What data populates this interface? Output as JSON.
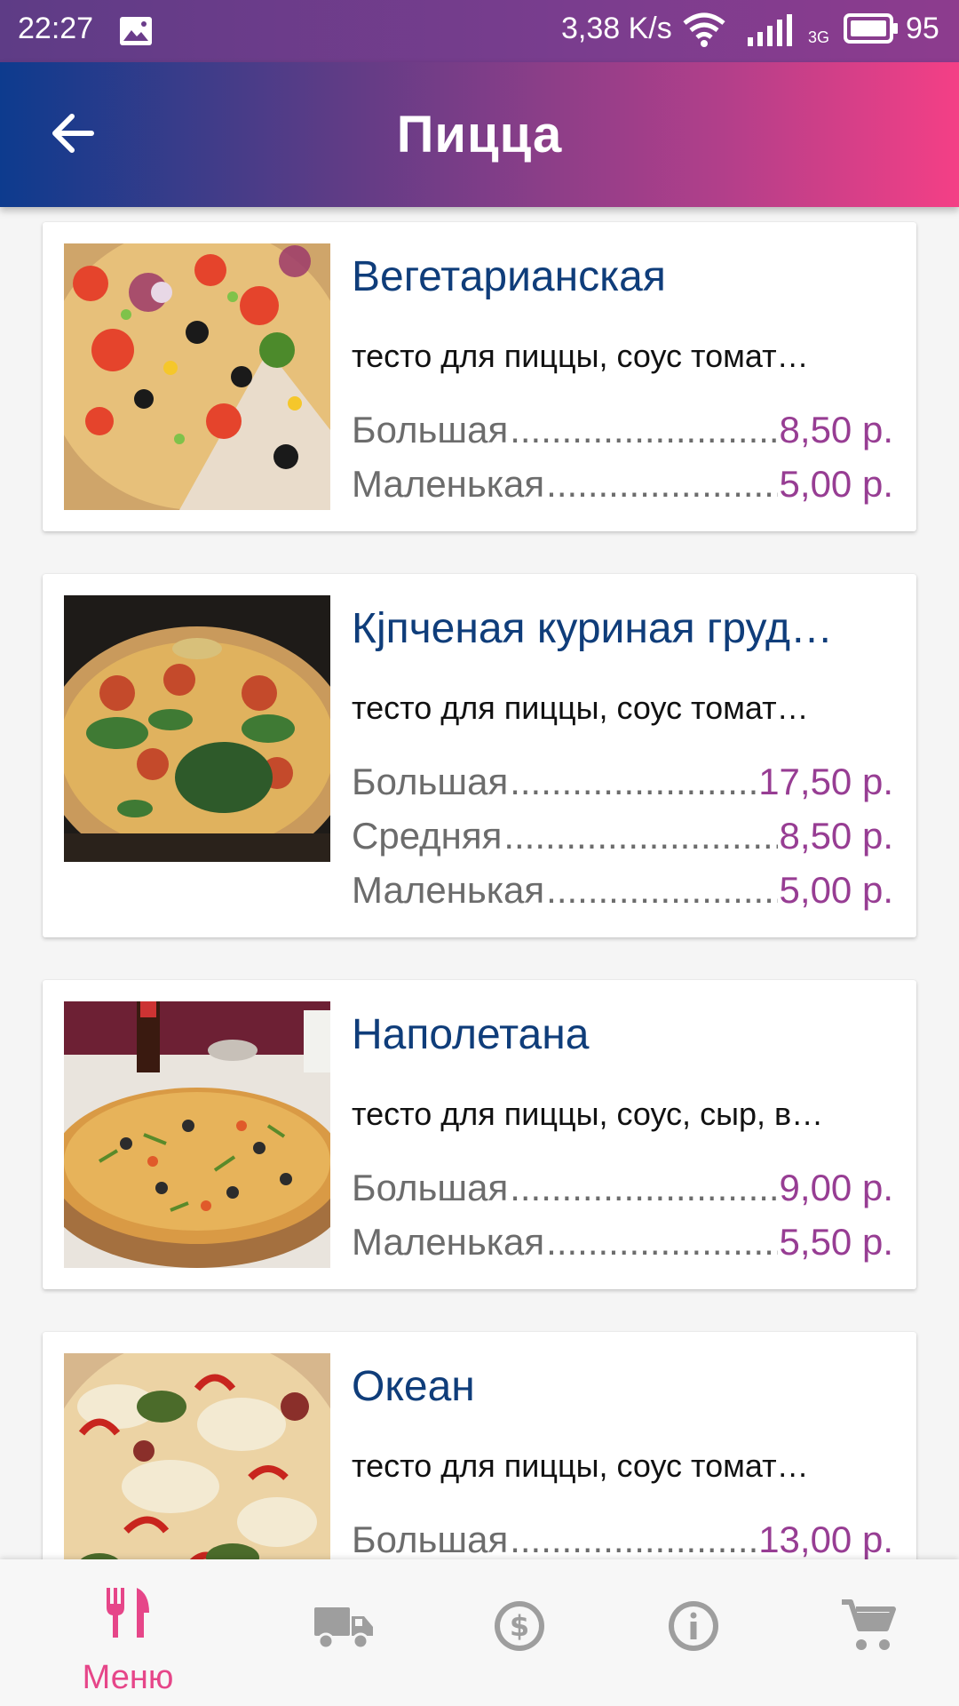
{
  "status_bar": {
    "time": "22:27",
    "speed": "3,38 K/s",
    "network": "3G",
    "battery": "95"
  },
  "app_bar": {
    "title": "Пицца",
    "back_icon": "arrow-left-icon"
  },
  "items": [
    {
      "name": "Вегетарианская",
      "description": "тесто для пиццы, соус томат…",
      "prices": [
        {
          "size": "Большая",
          "price": "8,50 р."
        },
        {
          "size": "Маленькая",
          "price": "5,00 р."
        }
      ]
    },
    {
      "name": "Кјпченая куриная груд…",
      "description": "тесто для пиццы, соус томат…",
      "prices": [
        {
          "size": "Большая",
          "price": "17,50 р."
        },
        {
          "size": "Средняя",
          "price": "8,50 р."
        },
        {
          "size": "Маленькая",
          "price": "5,00 р."
        }
      ]
    },
    {
      "name": "Наполетана",
      "description": "тесто для пиццы, соус, сыр, в…",
      "prices": [
        {
          "size": "Большая",
          "price": "9,00 р."
        },
        {
          "size": "Маленькая",
          "price": "5,50 р."
        }
      ]
    },
    {
      "name": "Океан",
      "description": "тесто для пиццы, соус томат…",
      "prices": [
        {
          "size": "Большая",
          "price": "13,00 р."
        }
      ]
    }
  ],
  "bottom_nav": {
    "menu_label": "Меню",
    "icons": [
      "fork-knife-icon",
      "truck-icon",
      "dollar-icon",
      "info-icon",
      "cart-icon"
    ]
  },
  "colors": {
    "accent": "#e64689",
    "title_blue": "#0f3d7a",
    "price_purple": "#973d93",
    "inactive_icon": "#9e9e9e"
  }
}
